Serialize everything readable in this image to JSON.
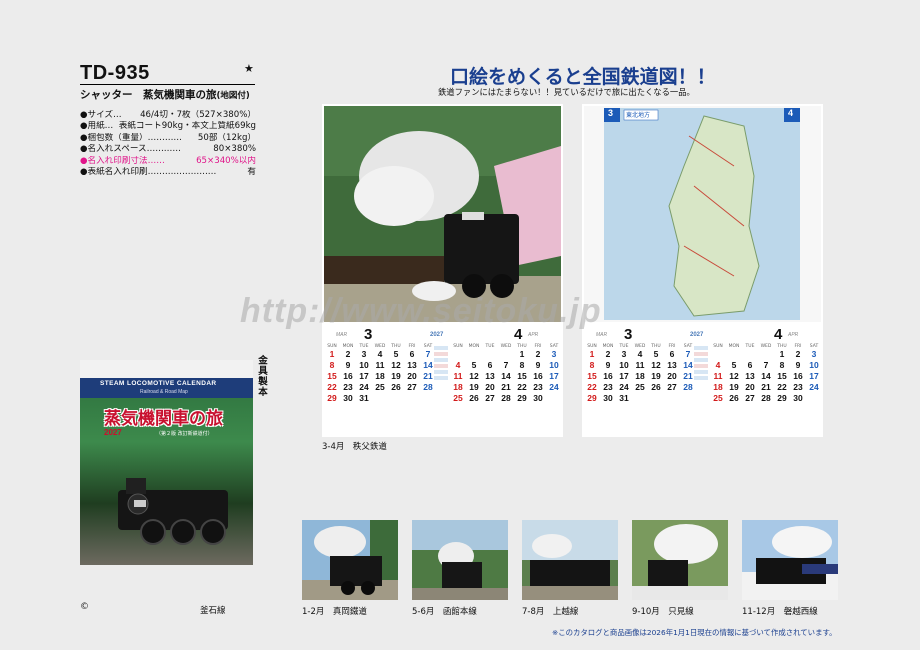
{
  "product": {
    "code": "TD-935",
    "star": "★",
    "title_main": "シャッター　蒸気機関車の旅",
    "title_suffix": "(地図付)"
  },
  "specs": [
    {
      "label": "●サイズ…",
      "value": "46/4切・7枚（527×380%）",
      "highlight": false
    },
    {
      "label": "●用紙…",
      "value": "表紙コート90kg・本文上質紙69kg",
      "highlight": false
    },
    {
      "label": "●梱包数（重量）…………",
      "value": "50部（12kg）",
      "highlight": false
    },
    {
      "label": "●名入れスペース…………",
      "value": "80×380%",
      "highlight": false
    },
    {
      "label": "●名入れ印刷寸法……",
      "value": "65×340%以内",
      "highlight": true
    },
    {
      "label": "●表紙名入れ印刷……………………",
      "value": "有",
      "highlight": false
    }
  ],
  "cover": {
    "strip_title": "STEAM LOCOMOTIVE CALENDAR",
    "strip_sub": "Railroad & Road Map",
    "title": "蒸気機関車の旅",
    "year": "2027",
    "note": "（第２版 改訂新鉄道付）",
    "binding": "金具製本",
    "copyright": "©",
    "caption": "釜石線"
  },
  "headline": "口絵をめくると全国鉄道図！！",
  "subheadline": "鉄道ファンにはたまらない！！見ているだけで旅に出たくなる一品。",
  "watermark": "http://www.seitoku.jp",
  "spread": {
    "caption": "3-4月　秩父鉄道",
    "year": "2027",
    "map_region": "東北地方",
    "month_left": "3",
    "month_left_en": "MAR",
    "month_right": "4",
    "month_right_en": "APR",
    "dow": [
      "SUN",
      "MON",
      "TUE",
      "WED",
      "THU",
      "FRI",
      "SAT"
    ],
    "march": [
      "1",
      "2",
      "3",
      "4",
      "5",
      "6",
      "7",
      "8",
      "9",
      "10",
      "11",
      "12",
      "13",
      "14",
      "15",
      "16",
      "17",
      "18",
      "19",
      "20",
      "21",
      "22",
      "23",
      "24",
      "25",
      "26",
      "27",
      "28",
      "29",
      "30",
      "31",
      "",
      "",
      ""
    ],
    "april": [
      "",
      "",
      "",
      "",
      "1",
      "2",
      "3",
      "4",
      "5",
      "6",
      "7",
      "8",
      "9",
      "10",
      "11",
      "12",
      "13",
      "14",
      "15",
      "16",
      "17",
      "18",
      "19",
      "20",
      "21",
      "22",
      "23",
      "24",
      "25",
      "26",
      "27",
      "28",
      "29",
      "30",
      ""
    ],
    "map_left_tab": "3",
    "map_right_tab": "4"
  },
  "thumbnails": [
    {
      "caption": "1-2月　真岡鐵道"
    },
    {
      "caption": "5-6月　函館本線"
    },
    {
      "caption": "7-8月　上越線"
    },
    {
      "caption": "9-10月　只見線"
    },
    {
      "caption": "11-12月　磐越西線"
    }
  ],
  "footnote": "※このカタログと商品画像は2026年1月1日現在の情報に基づいて作成されています。"
}
